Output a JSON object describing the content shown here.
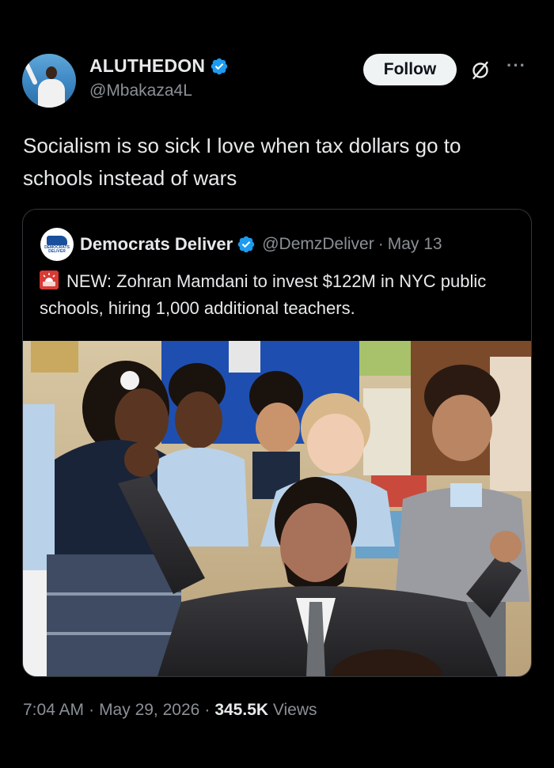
{
  "author": {
    "display_name": "ALUTHEDON",
    "handle": "@Mbakaza4L",
    "verified_icon": "verified-badge-icon"
  },
  "actions": {
    "follow_label": "Follow",
    "grok_icon": "grok-icon",
    "more_icon": "more-icon",
    "more_glyph": "···"
  },
  "tweet": {
    "text": "Socialism is so sick I love when tax dollars go to schools instead of wars"
  },
  "quoted": {
    "display_name": "Democrats Deliver",
    "handle": "@DemzDeliver",
    "separator": "·",
    "date": "May 13",
    "avatar_text": "DEMOCRATS DELIVER",
    "text": "NEW: Zohran Mamdani to invest $122M in NYC public schools, hiring 1,000 additional teachers.",
    "emoji_icon": "siren-icon"
  },
  "footer": {
    "time": "7:04 AM",
    "date": "May 29, 2026",
    "views_count": "345.5K",
    "views_label": "Views",
    "separator": "·"
  },
  "colors": {
    "background": "#000000",
    "text_primary": "#e7e9ea",
    "text_secondary": "#8b9096",
    "verified_blue": "#1d9bf0",
    "follow_bg": "#eff3f4",
    "border": "#33363a"
  }
}
